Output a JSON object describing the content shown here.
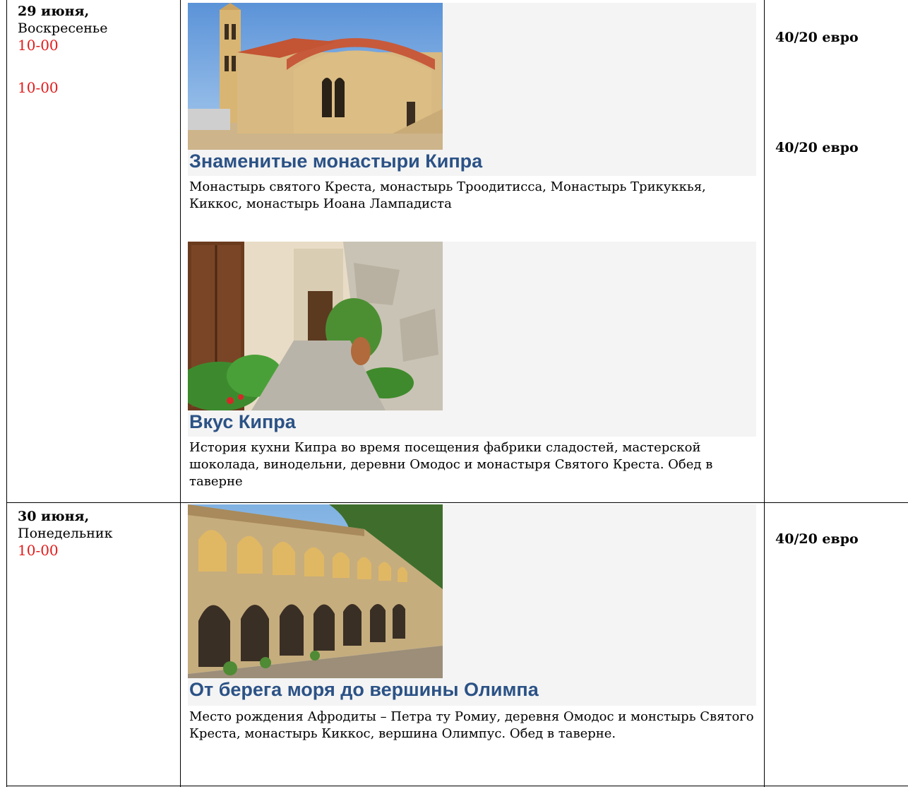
{
  "rows": [
    {
      "date": "29 июня,",
      "weekday": "Воскресенье",
      "times": [
        "10-00",
        "10-00"
      ],
      "prices": [
        "40/20 евро",
        "40/20 евро"
      ],
      "tours": [
        {
          "title": "Знаменитые монастыри Кипра",
          "description": "Монастырь святого Креста, монастырь Троодитисса, Монастырь Трикуккья, Киккос, монастырь Иоана Лампадиста"
        },
        {
          "title": "Вкус Кипра",
          "description": "История кухни Кипра во время посещения фабрики сладостей, мастерской шоколада, винодельни, деревни Омодос и монастыря Святого Креста.   Обед  в  таверне"
        }
      ]
    },
    {
      "date": "30 июня,",
      "weekday": "Понедельник",
      "times": [
        "10-00"
      ],
      "prices": [
        "40/20 евро"
      ],
      "tours": [
        {
          "title": "От берега моря до вершины Олимпа",
          "description": "Место рождения Афродиты – Петра ту Ромиу, деревня Омодос и монстырь Святого Креста, монастырь Киккос, вершина Олимпус. Обед в таверне."
        }
      ]
    }
  ]
}
